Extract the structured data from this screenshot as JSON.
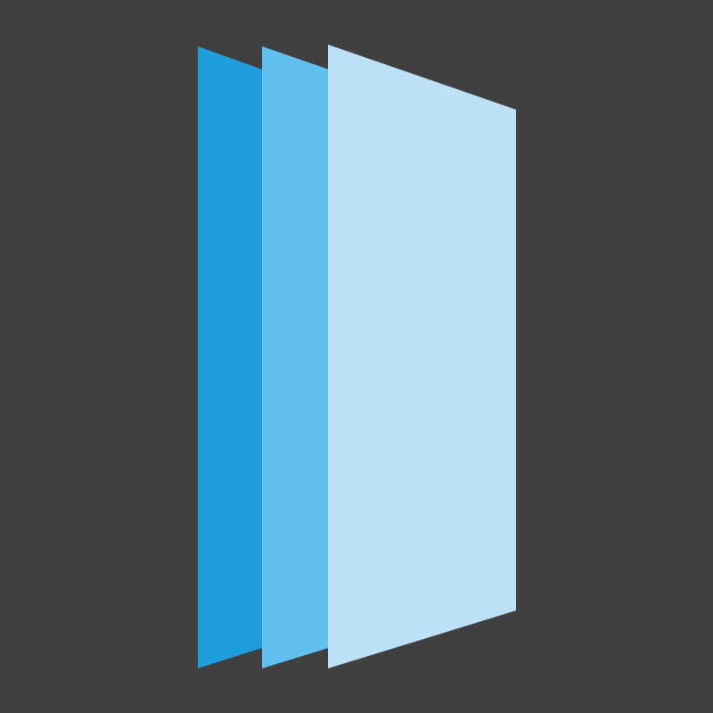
{
  "icon": {
    "name": "layered-pages-icon",
    "background_color": "#404040",
    "layers": [
      {
        "name": "back-page",
        "color": "#1e9fdb"
      },
      {
        "name": "middle-page",
        "color": "#61c0ef"
      },
      {
        "name": "front-page",
        "color": "#bce0f6"
      }
    ]
  }
}
